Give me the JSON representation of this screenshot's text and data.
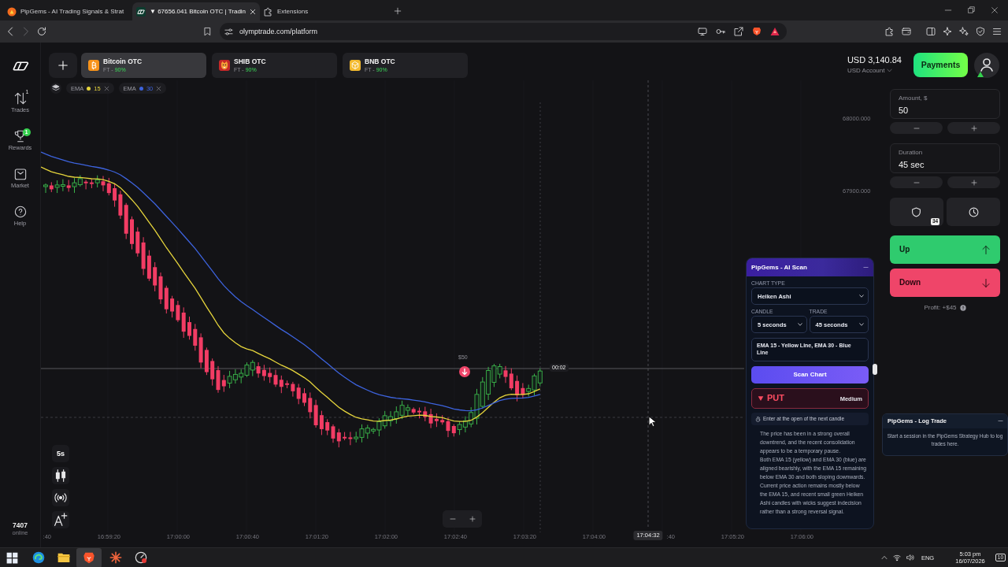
{
  "browser": {
    "tabs": [
      {
        "title": "PipGems - AI Trading Signals & Strat",
        "selected": false
      },
      {
        "title": "▼ 67656.041 Bitcoin OTC | Tradin",
        "selected": true
      },
      {
        "title": "Extensions",
        "selected": false
      }
    ],
    "url": "olymptrade.com/platform"
  },
  "sidebar": {
    "items": [
      {
        "label": "Trades",
        "badge": {
          "kind": "plain",
          "text": "1"
        }
      },
      {
        "label": "Rewards",
        "badge": {
          "kind": "dot",
          "text": "1"
        }
      },
      {
        "label": "Market"
      },
      {
        "label": "Help"
      }
    ],
    "online_count": "7407",
    "online_label": "online"
  },
  "assets": [
    {
      "name": "Bitcoin OTC",
      "mode": "FT -",
      "payout": "90%",
      "selected": true
    },
    {
      "name": "SHIB OTC",
      "mode": "FT -",
      "payout": "90%",
      "selected": false
    },
    {
      "name": "BNB OTC",
      "mode": "FT -",
      "payout": "90%",
      "selected": false
    }
  ],
  "indicators": [
    {
      "name": "EMA",
      "period": "15",
      "color": "#e6d53c"
    },
    {
      "name": "EMA",
      "period": "30",
      "color": "#3d63dd"
    }
  ],
  "account": {
    "balance": "USD 3,140.84",
    "name": "USD Account",
    "payments": "Payments"
  },
  "trade_panel": {
    "amount": {
      "label": "Amount, $",
      "value": "50"
    },
    "duration": {
      "label": "Duration",
      "value": "45 sec"
    },
    "protection_badge": "34",
    "up": "Up",
    "down": "Down",
    "profit": "Profit: +$45"
  },
  "chart": {
    "price_labels": [
      "68000.000",
      "67900.000"
    ],
    "time_labels": [
      ":40",
      "16:59:20",
      "17:00:00",
      "17:00:40",
      "17:01:20",
      "17:02:00",
      "17:02:40",
      "17:03:20",
      "17:04:00",
      ":40",
      "17:05:20",
      "17:06:00"
    ],
    "crosshair_time": "17:04:32",
    "timeframe": "5s",
    "trade_marker": {
      "kind": "down",
      "amount": "$50",
      "countdown": "00:02"
    }
  },
  "ai_scan": {
    "title": "PipGems - AI Scan",
    "chart_type": {
      "label": "CHART TYPE",
      "value": "Heiken Ashi"
    },
    "candle": {
      "label": "CANDLE",
      "value": "5 seconds"
    },
    "trade": {
      "label": "TRADE",
      "value": "45 seconds"
    },
    "notes": "EMA 15 - Yellow Line, EMA 30 - Blue Line",
    "scan_button": "Scan Chart",
    "signal": {
      "kind": "put",
      "label": "PUT",
      "confidence": "Medium"
    },
    "entry": "Enter at the open of the next candle",
    "analysis": [
      "The price has been in a strong overall downtrend, and the recent consolidation appears to be a temporary pause.",
      "Both EMA 15 (yellow) and EMA 30 (blue) are aligned bearishly, with the EMA 15 remaining below EMA 30 and both sloping downwards.",
      "Current price action remains mostly below the EMA 15, and recent small green Heiken Ashi candles with wicks suggest indecision rather than a strong reversal signal."
    ]
  },
  "log_trade": {
    "title": "PipGems - Log Trade",
    "message": "Start a session in the PipGems Strategy Hub to log trades here."
  },
  "taskbar": {
    "language": "ENG",
    "time": "5:03 pm",
    "date": "16/07/2026",
    "notifications": "10"
  }
}
